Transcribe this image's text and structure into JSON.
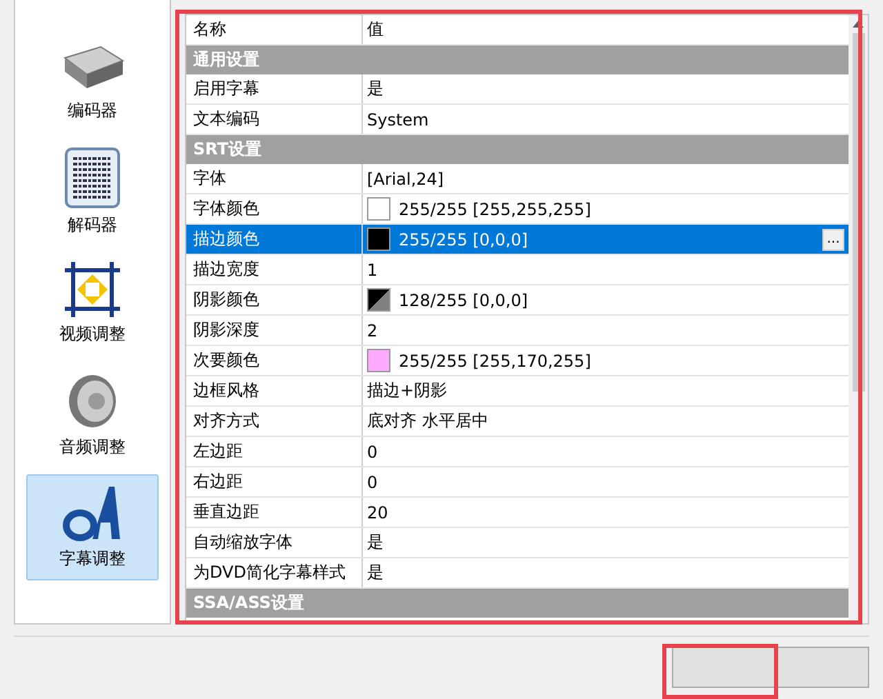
{
  "sidebar": {
    "items": [
      {
        "label": "编码器",
        "kind": "drive",
        "selected": false
      },
      {
        "label": "解码器",
        "kind": "grid",
        "selected": false
      },
      {
        "label": "视频调整",
        "kind": "frame",
        "selected": false
      },
      {
        "label": "音频调整",
        "kind": "speaker",
        "selected": false
      },
      {
        "label": "字幕调整",
        "kind": "letters",
        "selected": true
      }
    ]
  },
  "property_grid": {
    "columns": [
      "名称",
      "值"
    ],
    "rows": [
      {
        "kind": "category",
        "name": "通用设置"
      },
      {
        "kind": "property",
        "name": "启用字幕",
        "value": "是",
        "selected": false
      },
      {
        "kind": "property",
        "name": "文本编码",
        "value": "System",
        "selected": false
      },
      {
        "kind": "category",
        "name": "SRT设置"
      },
      {
        "kind": "property",
        "name": "字体",
        "value": "[Arial,24]",
        "selected": false
      },
      {
        "kind": "property",
        "name": "字体颜色",
        "value": "255/255 [255,255,255]",
        "selected": false,
        "swatch": {
          "color": "#ffffff",
          "translucent": false
        }
      },
      {
        "kind": "property",
        "name": "描边颜色",
        "value": "255/255 [0,0,0]",
        "selected": true,
        "swatch": {
          "color": "#000000",
          "translucent": false
        },
        "action": "..."
      },
      {
        "kind": "property",
        "name": "描边宽度",
        "value": "1",
        "selected": false
      },
      {
        "kind": "property",
        "name": "阴影颜色",
        "value": "128/255 [0,0,0]",
        "selected": false,
        "swatch": {
          "color": "#000000",
          "translucent": true
        }
      },
      {
        "kind": "property",
        "name": "阴影深度",
        "value": "2",
        "selected": false
      },
      {
        "kind": "property",
        "name": "次要颜色",
        "value": "255/255 [255,170,255]",
        "selected": false,
        "swatch": {
          "color": "#ffaaff",
          "translucent": false
        }
      },
      {
        "kind": "property",
        "name": "边框风格",
        "value": "描边+阴影",
        "selected": false
      },
      {
        "kind": "property",
        "name": "对齐方式",
        "value": "底对齐 水平居中",
        "selected": false
      },
      {
        "kind": "property",
        "name": "左边距",
        "value": "0",
        "selected": false
      },
      {
        "kind": "property",
        "name": "右边距",
        "value": "0",
        "selected": false
      },
      {
        "kind": "property",
        "name": "垂直边距",
        "value": "20",
        "selected": false
      },
      {
        "kind": "property",
        "name": "自动缩放字体",
        "value": "是",
        "selected": false
      },
      {
        "kind": "property",
        "name": "为DVD简化字幕样式",
        "value": "是",
        "selected": false
      },
      {
        "kind": "category",
        "name": "SSA/ASS设置"
      }
    ]
  }
}
